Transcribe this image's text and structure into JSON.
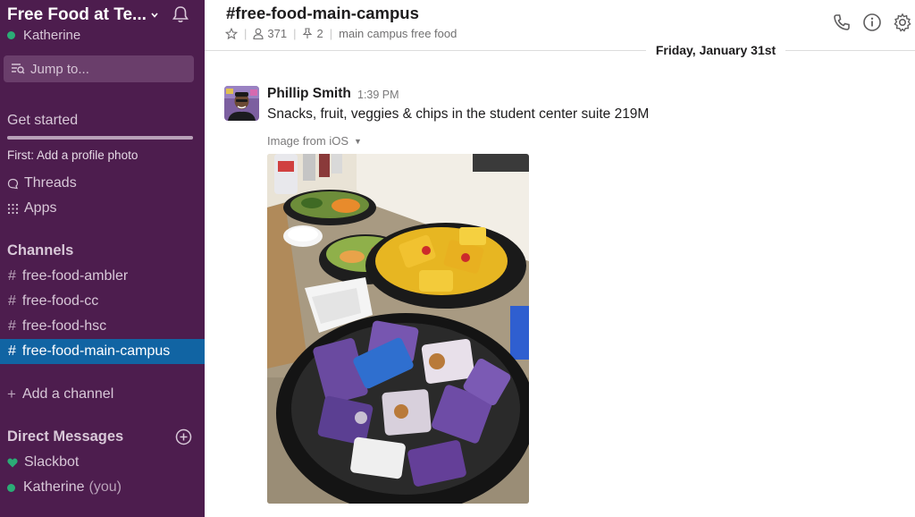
{
  "workspace": {
    "name": "Free Food at Te...",
    "user": "Katherine"
  },
  "sidebar": {
    "jump_to": "Jump to...",
    "get_started": "Get started",
    "get_started_progress": 1.0,
    "first_step": "First: Add a profile photo",
    "threads": "Threads",
    "apps": "Apps",
    "channels_title": "Channels",
    "channels": [
      {
        "name": "free-food-ambler",
        "active": false
      },
      {
        "name": "free-food-cc",
        "active": false
      },
      {
        "name": "free-food-hsc",
        "active": false
      },
      {
        "name": "free-food-main-campus",
        "active": true
      }
    ],
    "add_channel": "Add a channel",
    "dm_title": "Direct Messages",
    "dms": [
      {
        "name": "Slackbot",
        "suffix": ""
      },
      {
        "name": "Katherine",
        "suffix": "(you)"
      }
    ]
  },
  "channel": {
    "title": "#free-food-main-campus",
    "members": "371",
    "pinned": "2",
    "topic": "main campus free food"
  },
  "feed": {
    "day_divider": "Friday, January 31st",
    "message": {
      "author": "Phillip Smith",
      "time": "1:39 PM",
      "text": "Snacks, fruit, veggies & chips in the student center suite 219M",
      "file_label": "Image from iOS"
    }
  },
  "colors": {
    "sidebar_bg": "#4d1d4e",
    "active_channel": "#1164a3",
    "presence_green": "#2bac76"
  }
}
